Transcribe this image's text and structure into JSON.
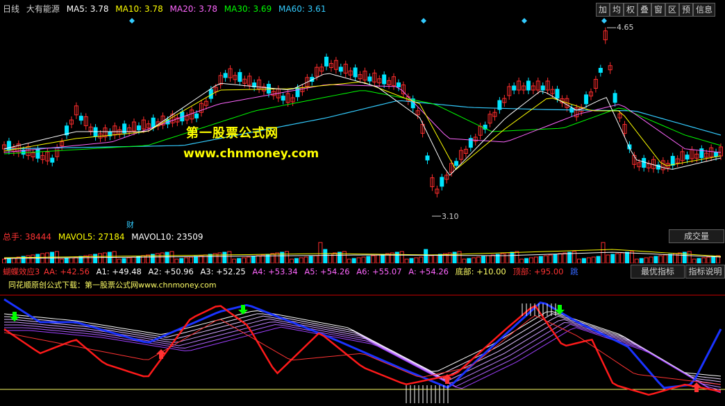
{
  "header": {
    "period": "日线",
    "stock_name": "大有能源",
    "ma5": "MA5: 3.78",
    "ma10": "MA10: 3.78",
    "ma20": "MA20: 3.78",
    "ma30": "MA30: 3.69",
    "ma60": "MA60: 3.61"
  },
  "toolbar": [
    "加",
    "均",
    "权",
    "叠",
    "窗",
    "区",
    "预",
    "信息"
  ],
  "colors": {
    "up": "#ff2d2d",
    "down": "#00e5ff",
    "ma5": "#ffffff",
    "ma10": "#ffff00",
    "ma20": "#ff66ff",
    "ma30": "#00ff00",
    "ma60": "#33ccff",
    "blue_line": "#1a33ff",
    "red_line": "#ff1a1a",
    "divider": "#a00000"
  },
  "price_annotations": {
    "high": "4.65",
    "low": "3.10",
    "fin_badge": "财"
  },
  "watermark": {
    "line1": "第一股票公式网",
    "line2": "www.chnmoney.com"
  },
  "volume_header": {
    "total": "总手: 38444",
    "mavol5": "MAVOL5: 27184",
    "mavol10": "MAVOL10: 23509",
    "tab": "成交量"
  },
  "indicator_header": {
    "name": "蝴蝶效应3",
    "aa": "AA: +42.56",
    "a1": "A1: +49.48",
    "a2": "A2: +50.96",
    "a3": "A3: +52.25",
    "a4": "A4: +53.34",
    "a5": "A5: +54.26",
    "a6": "A6: +55.07",
    "a": "A: +54.26",
    "bottom": "底部: +10.00",
    "top": "顶部: +95.00",
    "jump": "跳",
    "subtitle": "同花顺原创公式下载：第一股票公式网www.chnmoney.com",
    "tab_best": "最优指标",
    "tab_help": "指标说明"
  },
  "chart_data": {
    "type": "line",
    "title": "大有能源 日线",
    "price_high": 4.65,
    "price_low": 3.1,
    "ma": {
      "MA5": 3.78,
      "MA10": 3.78,
      "MA20": 3.78,
      "MA30": 3.69,
      "MA60": 3.61
    },
    "volume": {
      "total": 38444,
      "MAVOL5": 27184,
      "MAVOL10": 23509
    },
    "indicator": {
      "AA": 42.56,
      "A1": 49.48,
      "A2": 50.96,
      "A3": 52.25,
      "A4": 53.34,
      "A5": 54.26,
      "A6": 55.07,
      "A": 54.26,
      "bottom": 10.0,
      "top": 95.0
    }
  }
}
